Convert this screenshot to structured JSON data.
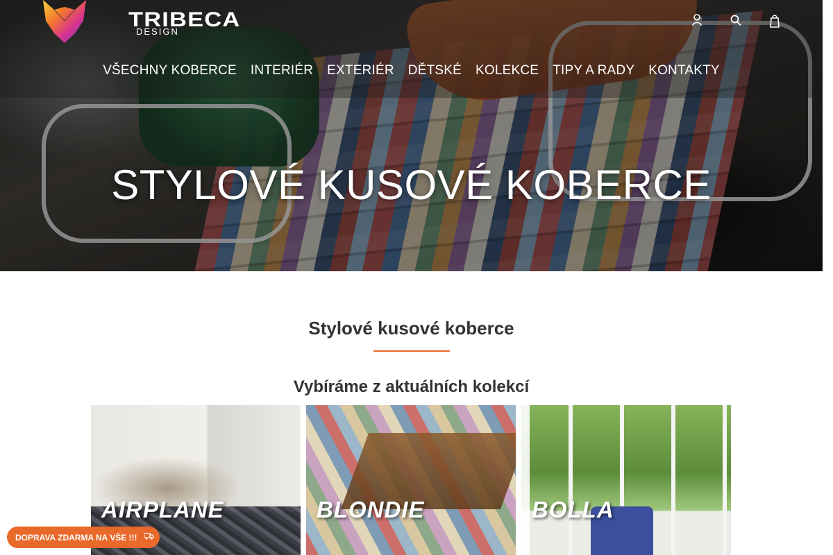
{
  "brand": {
    "name": "TRIBECA",
    "sub": "DESIGN"
  },
  "nav": {
    "items": [
      "VŠECHNY KOBERCE",
      "INTERIÉR",
      "EXTERIÉR",
      "DĚTSKÉ",
      "KOLEKCE",
      "TIPY A RADY",
      "KONTAKTY"
    ]
  },
  "header_icons": [
    "user-icon",
    "search-icon",
    "cart-icon"
  ],
  "hero": {
    "title": "STYLOVÉ KUSOVÉ KOBERCE"
  },
  "section": {
    "title": "Stylové kusové koberce",
    "subtitle": "Vybíráme z aktuálních kolekcí"
  },
  "collections": [
    {
      "label": "AIRPLANE"
    },
    {
      "label": "BLONDIE"
    },
    {
      "label": "BOLLA"
    }
  ],
  "promo": {
    "label": "DOPRAVA ZDARMA NA VŠE !!!",
    "icon": "truck-icon"
  },
  "colors": {
    "accent": "#e8692a",
    "text": "#333333",
    "header_overlay": "rgba(25,25,25,0.35)"
  }
}
